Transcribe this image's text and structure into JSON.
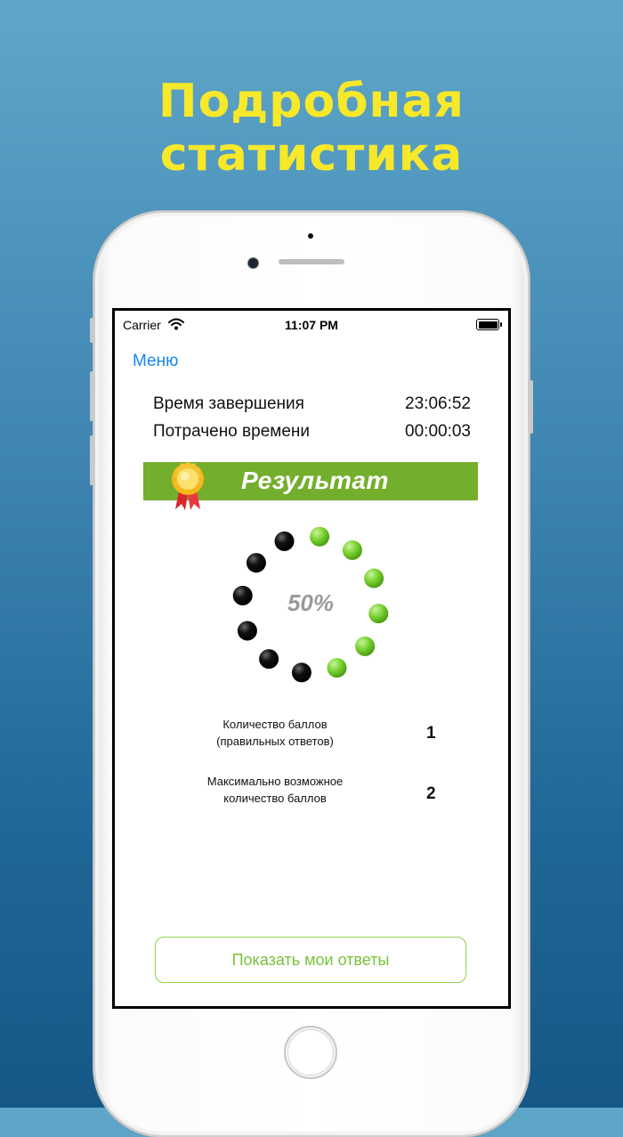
{
  "headline": "Подробная статистика",
  "status_bar": {
    "carrier": "Carrier",
    "time": "11:07 PM"
  },
  "nav": {
    "menu_label": "Меню"
  },
  "info": {
    "completion_label": "Время завершения",
    "completion_value": "23:06:52",
    "spent_label": "Потрачено времени",
    "spent_value": "00:00:03"
  },
  "result": {
    "banner_label": "Результат",
    "percent_text": "50%",
    "percent": 50,
    "dots_total": 12,
    "filled_color": "#76d12e",
    "empty_color": "#000000"
  },
  "scores": {
    "points_label_line1": "Количество баллов",
    "points_label_line2": "(правильных ответов)",
    "points_value": "1",
    "max_label_line1": "Максимально возможное",
    "max_label_line2": "количество баллов",
    "max_value": "2"
  },
  "actions": {
    "show_answers_label": "Показать мои ответы"
  },
  "colors": {
    "headline": "#f7e82a",
    "accent_blue": "#1a86f5",
    "banner_green": "#74ae2d",
    "button_green": "#78c23a"
  }
}
